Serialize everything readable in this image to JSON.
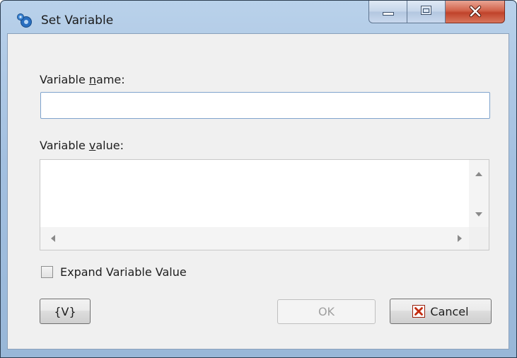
{
  "window": {
    "title": "Set Variable",
    "title_icon": "gear-balls-app-icon"
  },
  "caption_buttons": {
    "minimize_icon": "minimize-icon",
    "maximize_icon": "maximize-icon",
    "close_icon": "close-icon"
  },
  "form": {
    "name_label_prefix": "Variable ",
    "name_label_accel": "n",
    "name_label_suffix": "ame:",
    "name_value": "",
    "value_label_prefix": "Variable ",
    "value_label_accel": "v",
    "value_label_suffix": "alue:",
    "value_text": "",
    "expand_checkbox_label": "Expand Variable Value",
    "expand_checked": false
  },
  "buttons": {
    "variables_label": "{V}",
    "ok_label": "OK",
    "ok_enabled": false,
    "cancel_label": "Cancel",
    "cancel_icon": "red-x-icon"
  },
  "colors": {
    "title_bar": "#a9c4e2",
    "close_button": "#c9533a",
    "input_border": "#7fa3cc",
    "cancel_icon": "#c42b0f"
  }
}
